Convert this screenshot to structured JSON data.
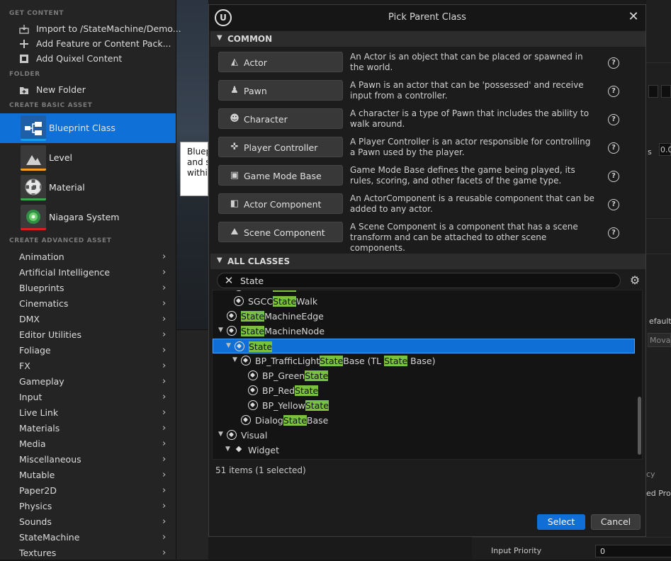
{
  "menu": {
    "get_content_head": "GET CONTENT",
    "get_content": [
      {
        "label": "Import to /StateMachine/Demo...",
        "icon": "import-icon"
      },
      {
        "label": "Add Feature or Content Pack...",
        "icon": "add-feature-icon"
      },
      {
        "label": "Add Quixel Content",
        "icon": "quixel-icon"
      }
    ],
    "folder_head": "FOLDER",
    "folder": [
      {
        "label": "New Folder",
        "icon": "new-folder-icon"
      }
    ],
    "basic_head": "CREATE BASIC ASSET",
    "basic": [
      {
        "label": "Blueprint Class",
        "color": "#1a9bf0"
      },
      {
        "label": "Level",
        "color": "#f59f1c"
      },
      {
        "label": "Material",
        "color": "#3fa64b"
      },
      {
        "label": "Niagara System",
        "color": "#d72020"
      }
    ],
    "advanced_head": "CREATE ADVANCED ASSET",
    "advanced": [
      "Animation",
      "Artificial Intelligence",
      "Blueprints",
      "Cinematics",
      "DMX",
      "Editor Utilities",
      "Foliage",
      "FX",
      "Gameplay",
      "Input",
      "Live Link",
      "Materials",
      "Media",
      "Miscellaneous",
      "Mutable",
      "Paper2D",
      "Physics",
      "Sounds",
      "StateMachine",
      "Textures"
    ]
  },
  "background": {
    "tooltip_lines": [
      "Bluep",
      "and s",
      "withi"
    ],
    "right_fragments": [
      "s",
      "0.0",
      "efault",
      "Movab",
      "ed Pro",
      "cy"
    ],
    "details_label": "Input Priority",
    "details_value": "0"
  },
  "dialog": {
    "logo_text": "U",
    "title": "Pick Parent Class",
    "common_head": "COMMON",
    "common": [
      {
        "label": "Actor",
        "icon": "actor-icon",
        "glyph": "◭",
        "desc": "An Actor is an object that can be placed or spawned in the world."
      },
      {
        "label": "Pawn",
        "icon": "pawn-icon",
        "glyph": "♟",
        "desc": "A Pawn is an actor that can be 'possessed' and receive input from a controller."
      },
      {
        "label": "Character",
        "icon": "character-icon",
        "glyph": "☻",
        "desc": "A character is a type of Pawn that includes the ability to walk around."
      },
      {
        "label": "Player Controller",
        "icon": "gamepad-icon",
        "glyph": "✜",
        "desc": "A Player Controller is an actor responsible for controlling a Pawn used by the player."
      },
      {
        "label": "Game Mode Base",
        "icon": "game-mode-icon",
        "glyph": "▣",
        "desc": "Game Mode Base defines the game being played, its rules, scoring, and other facets of the game type."
      },
      {
        "label": "Actor Component",
        "icon": "actor-component-icon",
        "glyph": "◧",
        "desc": "An ActorComponent is a reusable component that can be added to any actor."
      },
      {
        "label": "Scene Component",
        "icon": "scene-component-icon",
        "glyph": "⛰",
        "desc": "A Scene Component is a component that has a scene transform and can be attached to other scene components."
      }
    ],
    "all_classes_head": "ALL CLASSES",
    "search_value": "State",
    "tree": [
      {
        "pre": "SGCC",
        "hl": "State",
        "post": "Talk",
        "indent": 1,
        "exp": "",
        "icon": "node"
      },
      {
        "pre": "SGCC",
        "hl": "State",
        "post": "Walk",
        "indent": 1,
        "exp": "",
        "icon": "node"
      },
      {
        "pre": "",
        "hl": "State",
        "post": "MachineEdge",
        "indent": 0,
        "exp": "",
        "icon": "node"
      },
      {
        "pre": "",
        "hl": "State",
        "post": "MachineNode",
        "indent": 0,
        "exp": "▼",
        "icon": "node"
      },
      {
        "pre": "",
        "hl": "State",
        "post": "",
        "indent": 1,
        "exp": "▼",
        "icon": "node",
        "selected": true
      },
      {
        "pre": "BP_TrafficLight",
        "hl": "State",
        "post": "Base (TL ",
        "hl2": "State",
        "post2": " Base)",
        "indent": 2,
        "exp": "▼",
        "icon": "node"
      },
      {
        "pre": "BP_Green",
        "hl": "State",
        "post": "",
        "indent": 3,
        "exp": "",
        "icon": "node"
      },
      {
        "pre": "BP_Red",
        "hl": "State",
        "post": "",
        "indent": 3,
        "exp": "",
        "icon": "node"
      },
      {
        "pre": "BP_Yellow",
        "hl": "State",
        "post": "",
        "indent": 3,
        "exp": "",
        "icon": "node"
      },
      {
        "pre": "Dialog",
        "hl": "State",
        "post": "Base",
        "indent": 2,
        "exp": "",
        "icon": "node"
      },
      {
        "pre": "Visual",
        "hl": "",
        "post": "",
        "indent": 0,
        "exp": "▼",
        "icon": "node"
      },
      {
        "pre": "Widget",
        "hl": "",
        "post": "",
        "indent": 1,
        "exp": "▼",
        "icon": "dot"
      }
    ],
    "item_count": "51 items (1 selected)",
    "select_label": "Select",
    "cancel_label": "Cancel"
  }
}
